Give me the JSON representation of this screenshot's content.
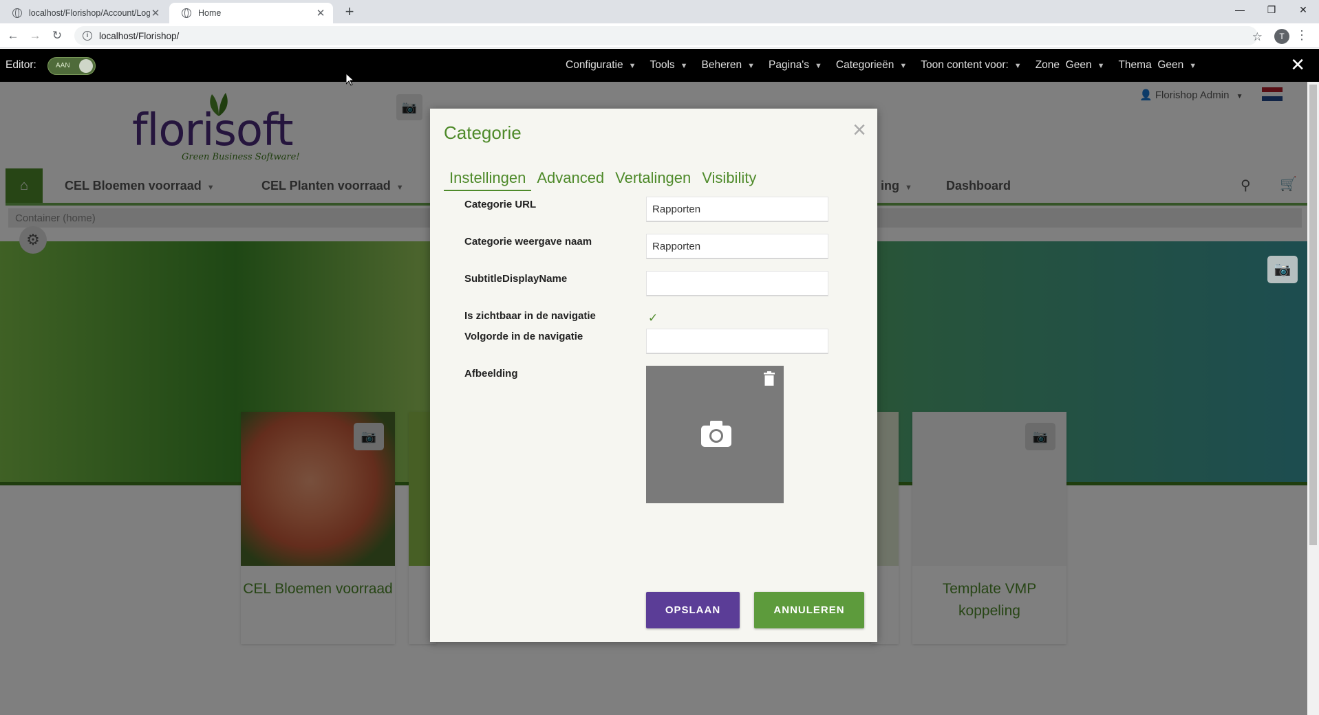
{
  "browser": {
    "tabs": [
      {
        "title": "localhost/Florishop/Account/Log",
        "active": false
      },
      {
        "title": "Home",
        "active": true
      }
    ],
    "url": "localhost/Florishop/",
    "profile_initial": "T"
  },
  "editor": {
    "label": "Editor:",
    "toggle_label": "AAN",
    "menu": [
      {
        "label": "Configuratie"
      },
      {
        "label": "Tools"
      },
      {
        "label": "Beheren"
      },
      {
        "label": "Pagina's"
      },
      {
        "label": "Categorieën"
      },
      {
        "label": "Toon content voor:"
      }
    ],
    "zone": {
      "label": "Zone",
      "value": "Geen"
    },
    "thema": {
      "label": "Thema",
      "value": "Geen"
    }
  },
  "header": {
    "logo_text": "florisoft",
    "logo_tagline": "Green Business Software!",
    "user": "Florishop Admin"
  },
  "nav": {
    "items": [
      "CEL Bloemen voorraad",
      "CEL Planten voorraad",
      "ing",
      "Dashboard"
    ]
  },
  "container_bar": {
    "label": "Container (home)"
  },
  "cards": [
    {
      "title": "CEL Bloemen voorraad"
    },
    {
      "title": "Template VMP koppeling"
    }
  ],
  "modal": {
    "title": "Categorie",
    "tabs": [
      "Instellingen",
      "Advanced",
      "Vertalingen",
      "Visibility"
    ],
    "fields": {
      "url": {
        "label": "Categorie URL",
        "value": "Rapporten"
      },
      "display_name": {
        "label": "Categorie weergave naam",
        "value": "Rapporten"
      },
      "subtitle": {
        "label": "SubtitleDisplayName",
        "value": ""
      },
      "visible": {
        "label": "Is zichtbaar in de navigatie",
        "checked": true
      },
      "order": {
        "label": "Volgorde in de navigatie",
        "value": ""
      },
      "image": {
        "label": "Afbeelding"
      }
    },
    "save_label": "OPSLAAN",
    "cancel_label": "ANNULEREN"
  },
  "colors": {
    "brand_green": "#4e8a2a",
    "brand_purple": "#5b3d97",
    "editor_bar": "#000000"
  }
}
